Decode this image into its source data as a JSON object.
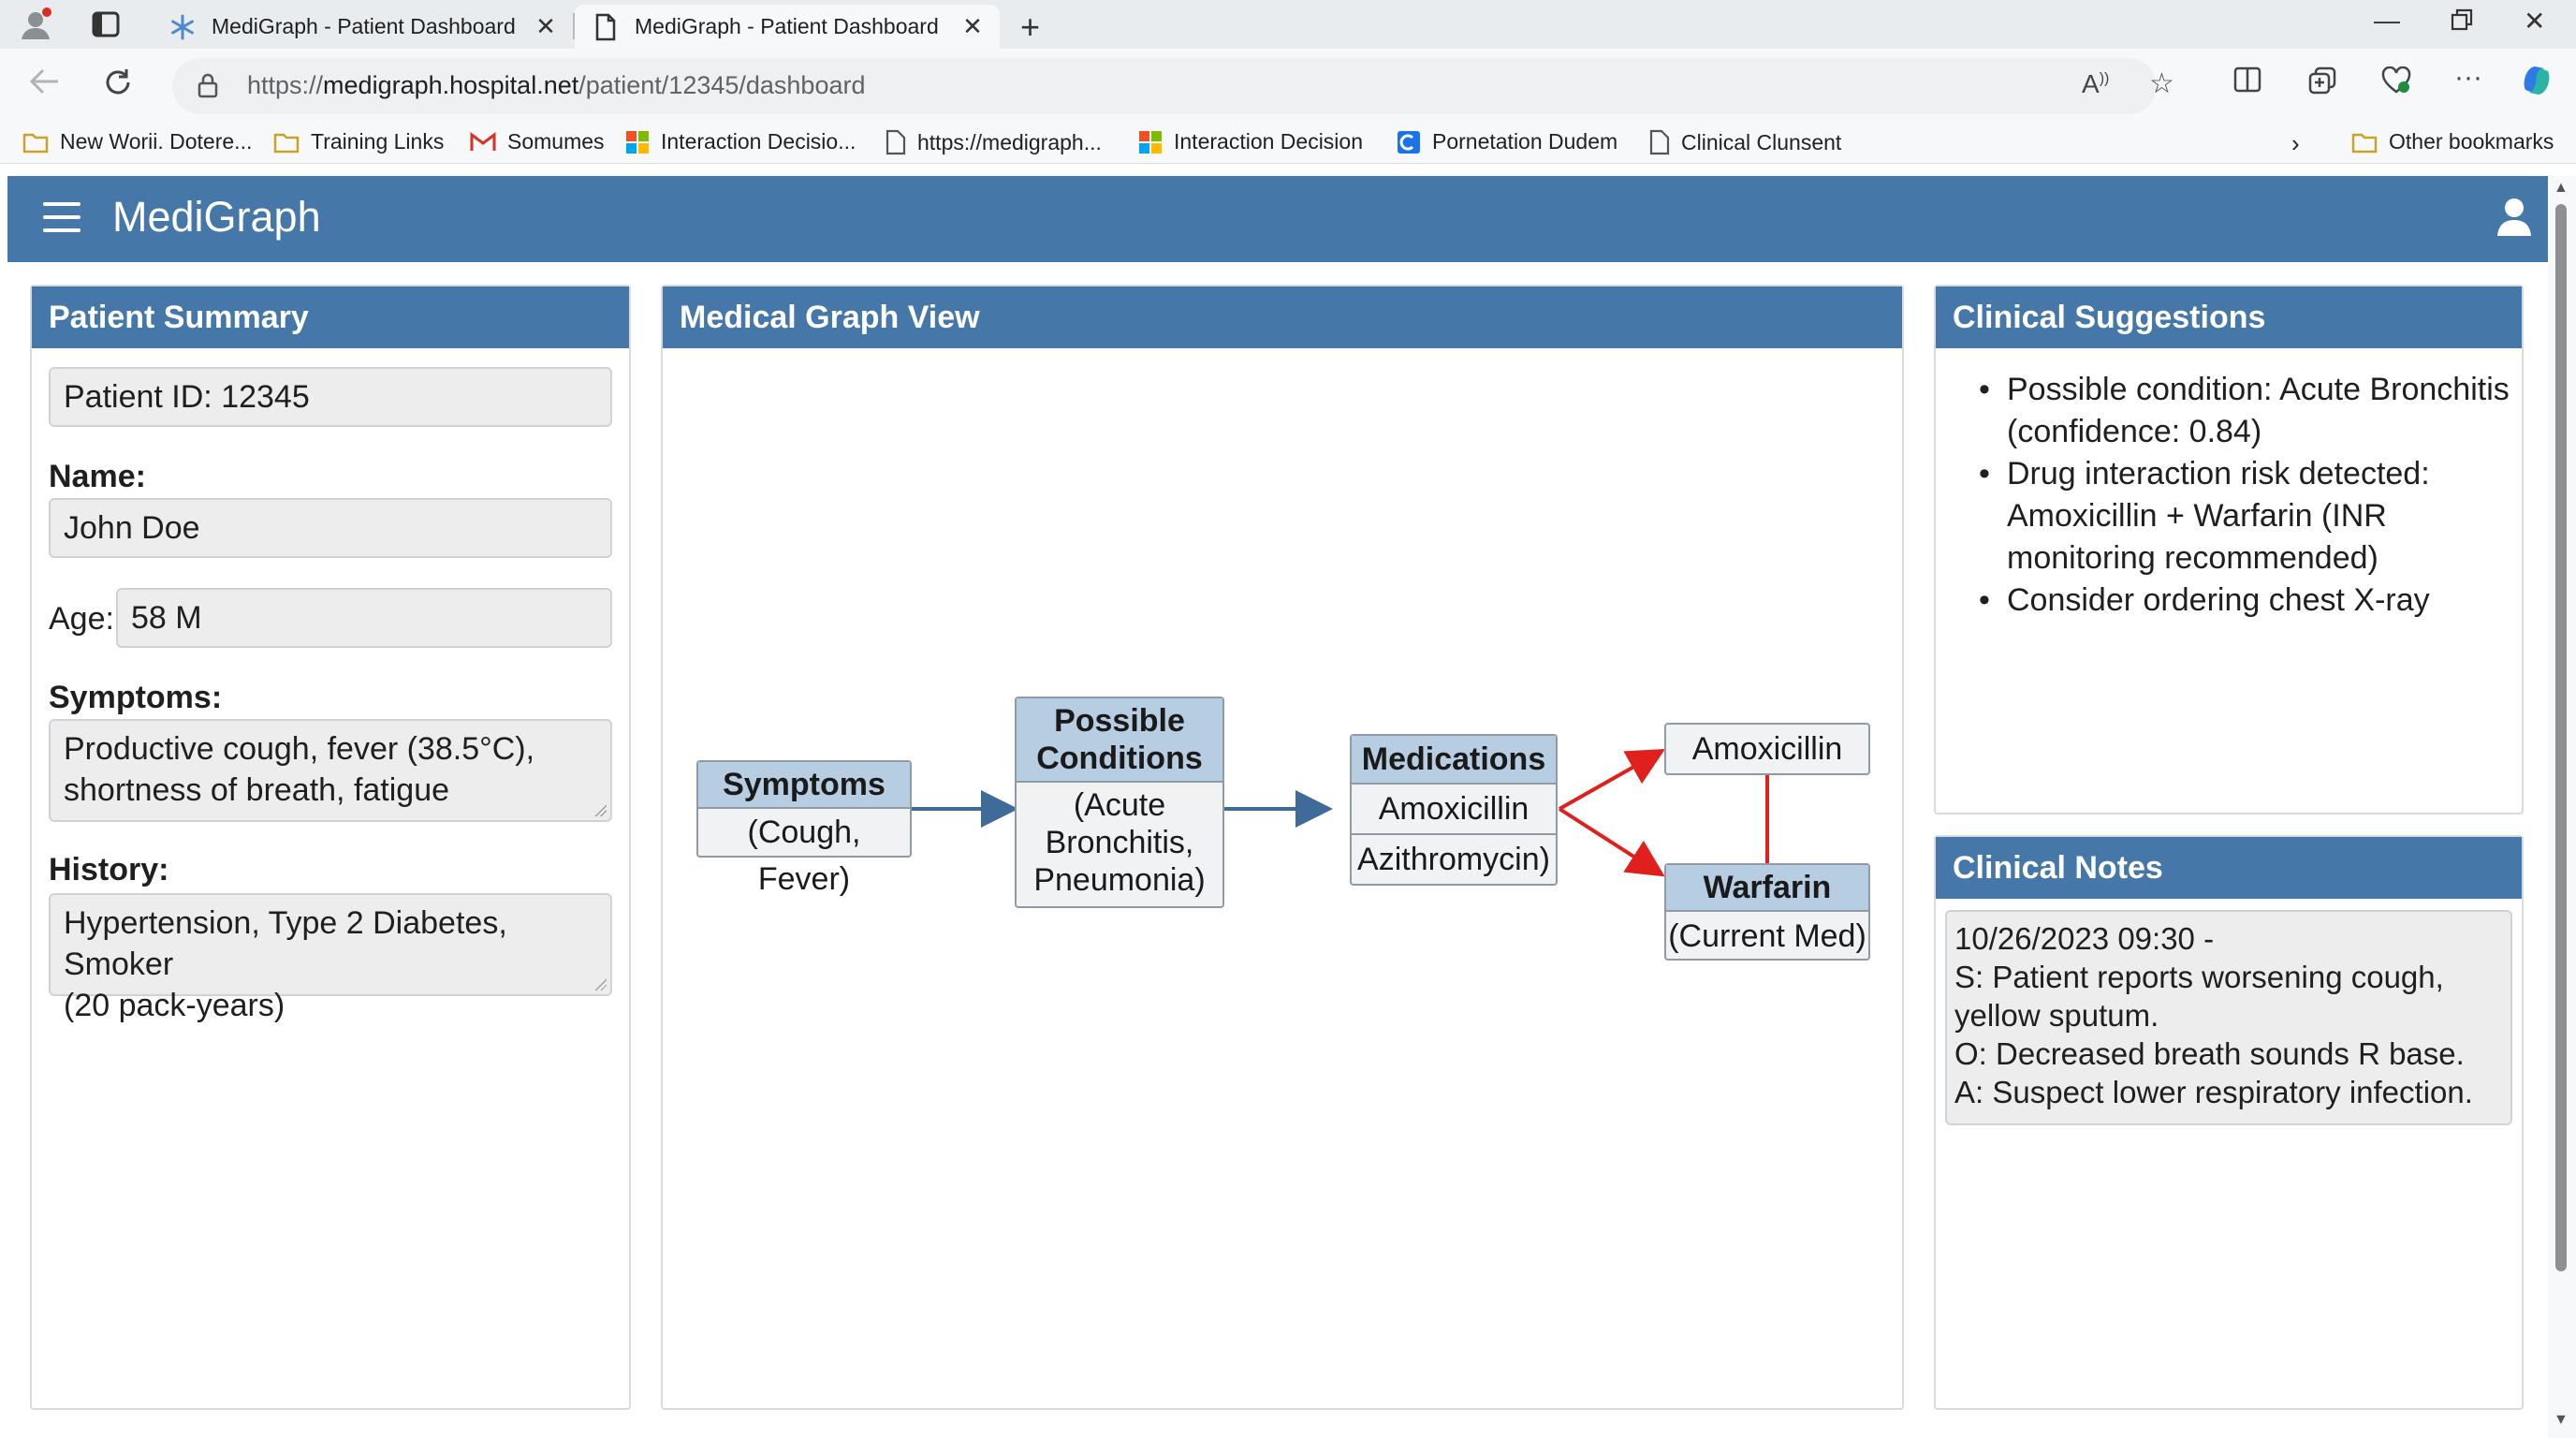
{
  "browser": {
    "tabs": [
      {
        "title": "MediGraph - Patient Dashboard",
        "active": false
      },
      {
        "title": "MediGraph - Patient Dashboard",
        "active": true
      }
    ],
    "url_scheme": "https://",
    "url_host": "medigraph.hospital.net",
    "url_path": "/patient/12345/dashboard",
    "bookmarks": [
      {
        "label": "New Worii. Dotere...",
        "icon": "folder-icon"
      },
      {
        "label": "Training Links",
        "icon": "folder-icon"
      },
      {
        "label": "Somumes",
        "icon": "gmail-icon"
      },
      {
        "label": "Interaction Decisio...",
        "icon": "microsoft-icon"
      },
      {
        "label": "https://medigraph...",
        "icon": "page-icon"
      },
      {
        "label": "Interaction Decision",
        "icon": "microsoft-icon"
      },
      {
        "label": "Pornetation Dudem",
        "icon": "app-icon"
      },
      {
        "label": "Clinical Clunsent",
        "icon": "page-icon"
      }
    ],
    "other_bookmarks": "Other bookmarks"
  },
  "app": {
    "title": "MediGraph",
    "accent": "#4577a8"
  },
  "patient_summary": {
    "heading": "Patient Summary",
    "patient_id": "Patient ID: 12345",
    "name_label": "Name:",
    "name_value": "John Doe",
    "age_label": "Age:",
    "age_value": "58 M",
    "symptoms_label": "Symptoms:",
    "symptoms_line1": "Productive cough, fever (38.5°C),",
    "symptoms_line2": "shortness of breath, fatigue",
    "history_label": "History:",
    "history_line1": "Hypertension, Type 2 Diabetes, Smoker",
    "history_line2": "(20 pack-years)"
  },
  "graph": {
    "heading": "Medical Graph View",
    "symptoms_title": "Symptoms",
    "symptoms_body": "(Cough, Fever)",
    "conditions_title1": "Possible",
    "conditions_title2": "Conditions",
    "conditions_body1": "(Acute",
    "conditions_body2": "Bronchitis,",
    "conditions_body3": "Pneumonia)",
    "medications_title": "Medications",
    "medication_1": "Amoxicillin",
    "medication_2": "Azithromycin)",
    "amoxicillin_node": "Amoxicillin",
    "warfarin_title": "Warfarin",
    "warfarin_body": "(Current Med)",
    "flow_color": "#3f6b98",
    "risk_color": "#e0201c"
  },
  "suggestions": {
    "heading": "Clinical Suggestions",
    "items": [
      {
        "line1": "Possible condition: Acute Bronchitis",
        "line2": "(confidence: 0.84)"
      },
      {
        "line1": "Drug interaction risk detected:",
        "line2": "Amoxicillin + Warfarin (INR",
        "line3": "monitoring recommended)"
      },
      {
        "line1": "Consider ordering chest X-ray"
      }
    ]
  },
  "notes": {
    "heading": "Clinical Notes",
    "lines": [
      "10/26/2023 09:30 -",
      "S: Patient reports worsening cough,",
      "yellow sputum.",
      "O: Decreased breath sounds R base.",
      "A: Suspect lower respiratory infection."
    ]
  }
}
